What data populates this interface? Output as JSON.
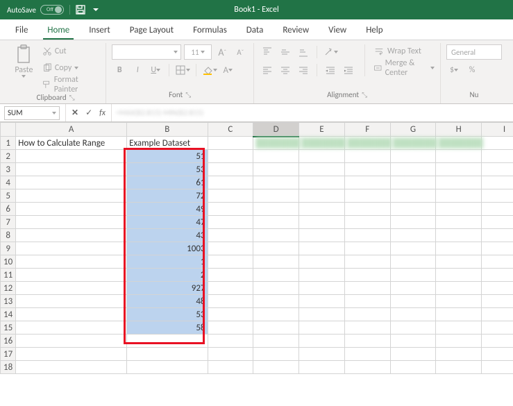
{
  "titlebar": {
    "autosave_label": "AutoSave",
    "autosave_state": "Off",
    "book_title": "Book1 - Excel"
  },
  "tabs": {
    "file": "File",
    "home": "Home",
    "insert": "Insert",
    "page_layout": "Page Layout",
    "formulas": "Formulas",
    "data": "Data",
    "review": "Review",
    "view": "View",
    "help": "Help"
  },
  "ribbon": {
    "clipboard": {
      "paste": "Paste",
      "cut": "Cut",
      "copy": "Copy",
      "format_painter": "Format Painter",
      "label": "Clipboard"
    },
    "font": {
      "size": "11",
      "incA": "A",
      "decA": "A",
      "bold": "B",
      "italic": "I",
      "underline": "U",
      "label": "Font"
    },
    "alignment": {
      "wrap": "Wrap Text",
      "merge": "Merge & Center",
      "label": "Alignment"
    },
    "number": {
      "general": "General",
      "currency": "$",
      "percent": "%",
      "label": "Nu"
    }
  },
  "formula_bar": {
    "name_box": "SUM",
    "fx": "fx",
    "formula_blur": "=MAX(B2:B15)-MIN(B2:B15)"
  },
  "grid": {
    "columns": [
      "A",
      "B",
      "C",
      "D",
      "E",
      "F",
      "G",
      "H",
      "I"
    ],
    "rows": [
      1,
      2,
      3,
      4,
      5,
      6,
      7,
      8,
      9,
      10,
      11,
      12,
      13,
      14,
      15,
      16,
      17,
      18
    ],
    "cells": {
      "A1": "How to Calculate Range",
      "B1": "Example Dataset",
      "B2": 51,
      "B3": 53,
      "B4": 61,
      "B5": 72,
      "B6": 49,
      "B7": 47,
      "B8": 43,
      "B9": 1003,
      "B10": 1,
      "B11": 2,
      "B12": 927,
      "B13": 48,
      "B14": 53,
      "B15": 58
    },
    "selection": {
      "start": "B2",
      "end": "B15"
    },
    "highlight_outline": {
      "col": "B",
      "row_start": 2,
      "row_end": 15
    },
    "active_col_header": "D"
  },
  "colors": {
    "brand": "#217346",
    "selection_outline": "#e81123"
  }
}
